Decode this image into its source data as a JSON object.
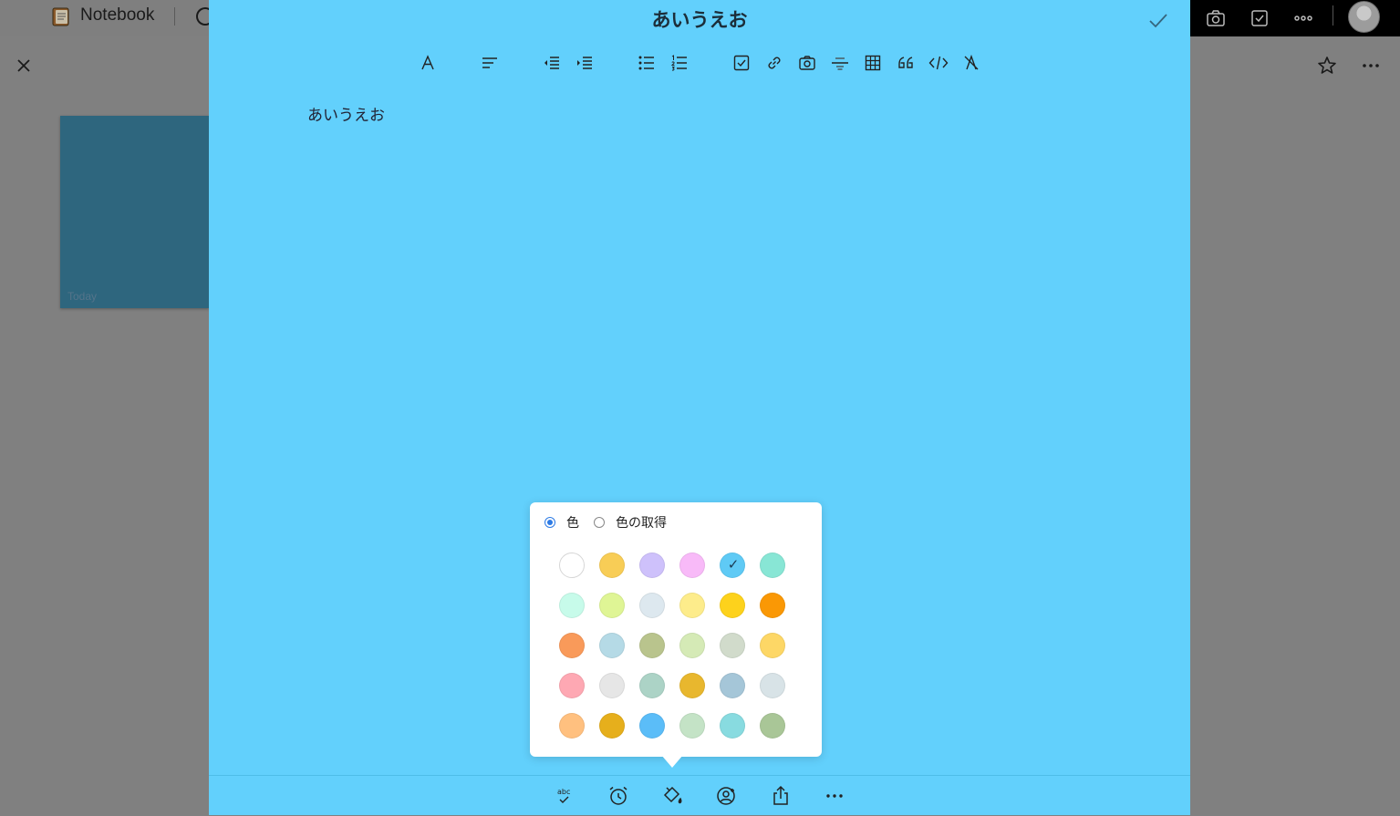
{
  "background_app": {
    "title": "Notebook",
    "card_date": "Today"
  },
  "editor": {
    "title": "あいうえお",
    "body_text": "あいうえお",
    "background_color": "#62d0fc",
    "toolbar_icons": [
      "font-icon",
      "align-icon",
      "outdent-icon",
      "indent-icon",
      "bullet-list-icon",
      "numbered-list-icon",
      "checkbox-icon",
      "link-icon",
      "camera-icon",
      "strikethrough-icon",
      "table-icon",
      "quote-icon",
      "code-icon",
      "clear-format-icon"
    ],
    "bottom_icons": [
      "spellcheck-icon",
      "alarm-icon",
      "paint-bucket-icon",
      "share-user-icon",
      "share-icon",
      "more-icon"
    ]
  },
  "color_popup": {
    "option_color": "色",
    "option_get_color": "色の取得",
    "selected_option": "色",
    "selected_swatch_index": 4,
    "swatches": [
      "#ffffff",
      "#f8cd56",
      "#cec1fb",
      "#f8baf8",
      "#5fcaf5",
      "#88e6d5",
      "#c7fbea",
      "#dff595",
      "#dde8ef",
      "#fdec8b",
      "#fdd21c",
      "#fa9805",
      "#f99a5a",
      "#b5dae6",
      "#b9c48d",
      "#d5eab6",
      "#d1dbcb",
      "#fdd766",
      "#fea8b3",
      "#e6e6e6",
      "#acd3c6",
      "#e8b72e",
      "#a5c6d8",
      "#d8e3e7",
      "#ffc07f",
      "#e6af1c",
      "#5bbdf8",
      "#c4e3c6",
      "#88dbe0",
      "#a9c697"
    ]
  }
}
